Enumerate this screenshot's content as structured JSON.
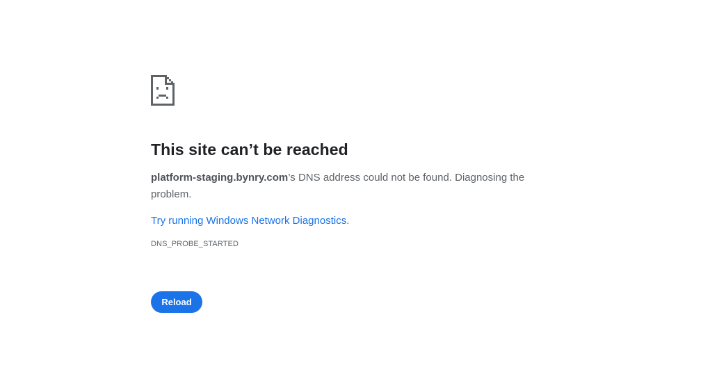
{
  "error": {
    "icon": "sad-page-icon",
    "heading": "This site can’t be reached",
    "host": "platform-staging.bynry.com",
    "message_rest": "’s DNS address could not be found. Diagnosing the problem.",
    "suggestion_link": "Try running Windows Network Diagnostics.",
    "error_code": "DNS_PROBE_STARTED"
  },
  "actions": {
    "reload_label": "Reload"
  },
  "colors": {
    "accent": "#1a73e8",
    "heading": "#202124",
    "body_text": "#5f6368",
    "background": "#ffffff"
  }
}
